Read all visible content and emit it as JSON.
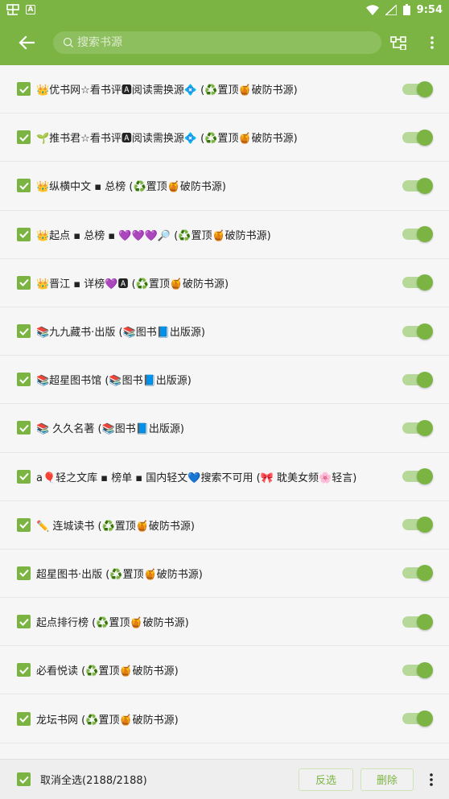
{
  "status_bar": {
    "time": "9:54",
    "notif_badge": "A"
  },
  "toolbar": {
    "search_placeholder": "搜索书源"
  },
  "sources": [
    {
      "label": "👑优书网☆看书评🅰阅读需换源💠 (♻️置顶🍯破防书源)"
    },
    {
      "label": "🌱推书君☆看书评🅰阅读需换源💠 (♻️置顶🍯破防书源)"
    },
    {
      "label": "👑纵横中文 ▪ 总榜 (♻️置顶🍯破防书源)"
    },
    {
      "label": "👑起点 ▪ 总榜 ▪ 💜💜💜🔎 (♻️置顶🍯破防书源)"
    },
    {
      "label": "👑晋江 ▪ 详榜💜🅰 (♻️置顶🍯破防书源)"
    },
    {
      "label": "📚九九藏书·出版 (📚图书📘出版源)"
    },
    {
      "label": "📚超星图书馆 (📚图书📘出版源)"
    },
    {
      "label": "📚 久久名著  (📚图书📘出版源)"
    },
    {
      "label": "a🎈轻之文库 ▪ 榜单 ▪ 国内轻文💙搜索不可用 (🎀 耽美女频🌸轻言)"
    },
    {
      "label": "✏️ 连城读书 (♻️置顶🍯破防书源)"
    },
    {
      "label": "超星图书·出版 (♻️置顶🍯破防书源)"
    },
    {
      "label": "起点排行榜 (♻️置顶🍯破防书源)"
    },
    {
      "label": "必看悦读 (♻️置顶🍯破防书源)"
    },
    {
      "label": "龙坛书网 (♻️置顶🍯破防书源)"
    }
  ],
  "bottom_bar": {
    "select_all_label": "取消全选(2188/2188)",
    "invert_label": "反选",
    "delete_label": "删除"
  },
  "colors": {
    "accent": "#7bb443",
    "switch_track": "#b6d99a"
  }
}
